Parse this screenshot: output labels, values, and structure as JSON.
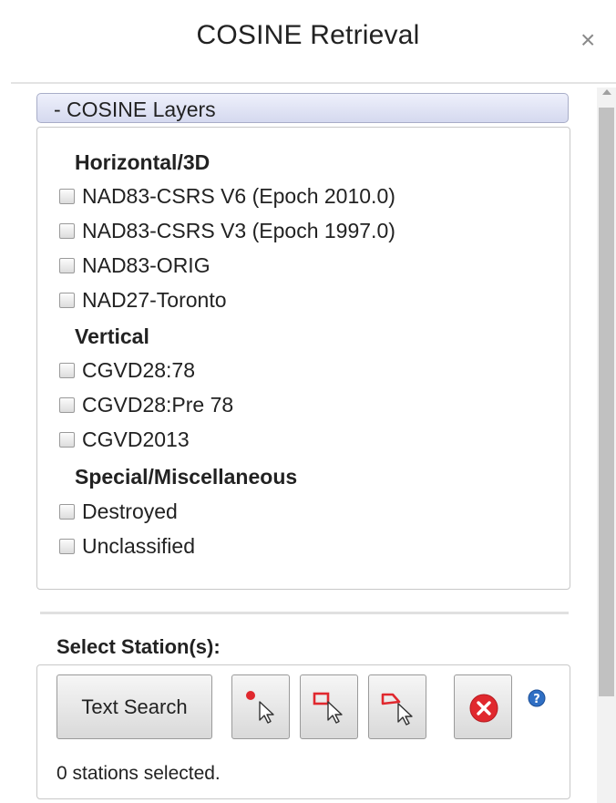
{
  "header": {
    "title": "COSINE Retrieval",
    "close_glyph": "×"
  },
  "layers_panel": {
    "heading": "- COSINE Layers",
    "groups": [
      {
        "title": "Horizontal/3D",
        "items": [
          {
            "label": "NAD83-CSRS V6 (Epoch 2010.0)",
            "checked": false
          },
          {
            "label": "NAD83-CSRS V3 (Epoch 1997.0)",
            "checked": false
          },
          {
            "label": "NAD83-ORIG",
            "checked": false
          },
          {
            "label": "NAD27-Toronto",
            "checked": false
          }
        ]
      },
      {
        "title": "Vertical",
        "items": [
          {
            "label": "CGVD28:78",
            "checked": false
          },
          {
            "label": "CGVD28:Pre 78",
            "checked": false
          },
          {
            "label": "CGVD2013",
            "checked": false
          }
        ]
      },
      {
        "title": "Special/Miscellaneous",
        "items": [
          {
            "label": "Destroyed",
            "checked": false
          },
          {
            "label": "Unclassified",
            "checked": false
          }
        ]
      }
    ]
  },
  "select_stations": {
    "label": "Select Station(s):",
    "text_search_label": "Text Search",
    "tools": [
      {
        "icon": "point-select-icon"
      },
      {
        "icon": "rectangle-select-icon"
      },
      {
        "icon": "polygon-select-icon"
      }
    ],
    "clear_icon": "clear-selection-icon",
    "help_icon": "help-icon",
    "status": "0 stations selected."
  },
  "colors": {
    "accent_red": "#e0282e",
    "help_blue": "#2f6fc4",
    "panel_header": "#d5d9ef"
  }
}
